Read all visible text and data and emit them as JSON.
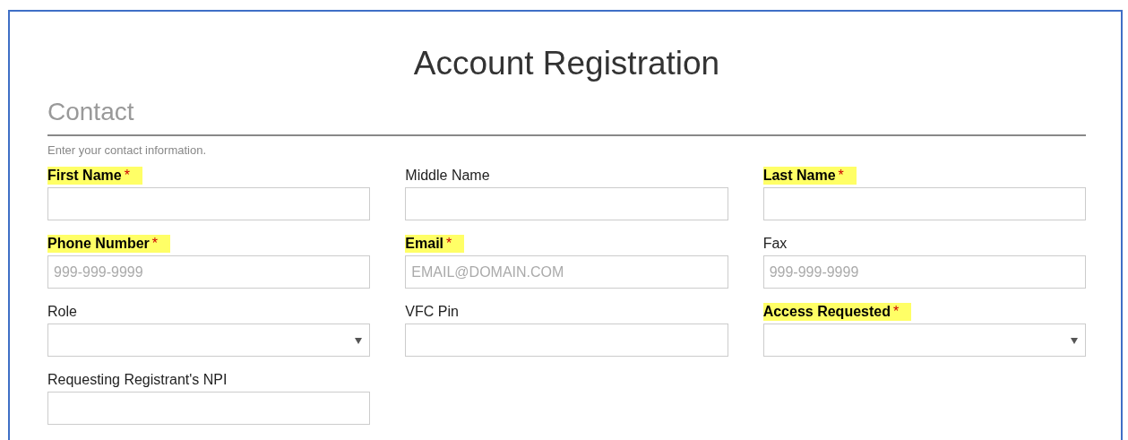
{
  "page": {
    "title": "Account Registration"
  },
  "section": {
    "heading": "Contact",
    "hint": "Enter your contact information."
  },
  "fields": [
    {
      "label": "First Name",
      "required_mark": "*",
      "highlighted": true,
      "kind": "text"
    },
    {
      "label": "Middle Name",
      "highlighted": false,
      "kind": "text"
    },
    {
      "label": "Last Name",
      "required_mark": "*",
      "highlighted": true,
      "kind": "text"
    },
    {
      "label": "Phone Number",
      "required_mark": "*",
      "highlighted": true,
      "kind": "text",
      "placeholder": "999-999-9999"
    },
    {
      "label": "Email",
      "required_mark": "*",
      "highlighted": true,
      "kind": "text",
      "placeholder": "EMAIL@DOMAIN.COM"
    },
    {
      "label": "Fax",
      "highlighted": false,
      "kind": "text",
      "placeholder": "999-999-9999"
    },
    {
      "label": "Role",
      "highlighted": false,
      "kind": "select"
    },
    {
      "label": "VFC Pin",
      "highlighted": false,
      "kind": "text"
    },
    {
      "label": "Access Requested",
      "required_mark": "*",
      "highlighted": true,
      "kind": "select"
    },
    {
      "label": "Requesting Registrant's NPI",
      "highlighted": false,
      "kind": "text"
    }
  ]
}
